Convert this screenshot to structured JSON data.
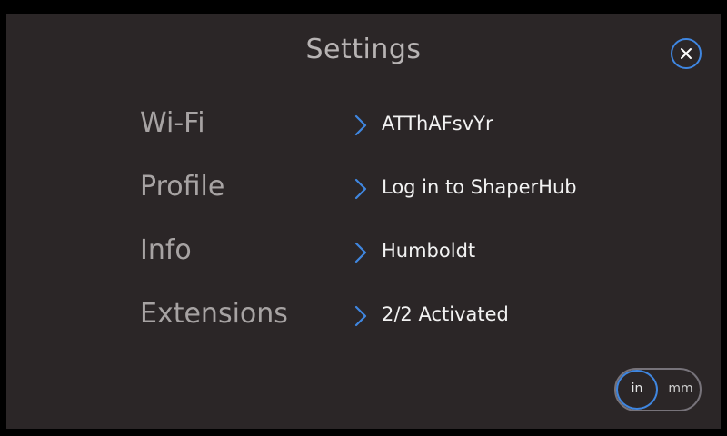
{
  "header": {
    "title": "Settings"
  },
  "close": {
    "icon": "close-icon"
  },
  "menu": {
    "items": [
      {
        "label": "Wi-Fi",
        "value": "ATThAFsvYr",
        "icon": "chevron-right-icon"
      },
      {
        "label": "Profile",
        "value": "Log in to ShaperHub",
        "icon": "chevron-right-icon"
      },
      {
        "label": "Info",
        "value": "Humboldt",
        "icon": "chevron-right-icon"
      },
      {
        "label": "Extensions",
        "value": "2/2 Activated",
        "icon": "chevron-right-icon"
      }
    ]
  },
  "units": {
    "options": [
      "in",
      "mm"
    ],
    "selected": "in"
  },
  "colors": {
    "background": "#2b2627",
    "accent": "#3f86e0",
    "label": "#a7a3a3",
    "value": "#f2f2f2"
  }
}
